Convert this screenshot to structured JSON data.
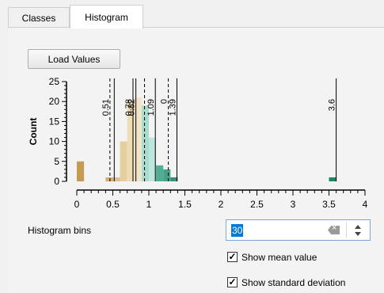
{
  "tabs": [
    {
      "label": "Classes",
      "active": false
    },
    {
      "label": "Histogram",
      "active": true
    }
  ],
  "load_button_label": "Load Values",
  "chart_data": {
    "type": "bar",
    "ylabel": "Count",
    "xlabel": "",
    "xlim": [
      0,
      4
    ],
    "ylim": [
      0,
      25
    ],
    "x_ticks": [
      "0",
      "0.5",
      "1",
      "1.5",
      "2",
      "2.5",
      "3",
      "3.5",
      "4"
    ],
    "y_ticks": [
      "0",
      "5",
      "10",
      "15",
      "20",
      "25"
    ],
    "bin_width": 0.1,
    "bars": [
      {
        "x0": 0.0,
        "value": 5,
        "color": "#c79a54"
      },
      {
        "x0": 0.4,
        "value": 1,
        "color": "#d4ad70"
      },
      {
        "x0": 0.5,
        "value": 1,
        "color": "#dcc08d"
      },
      {
        "x0": 0.6,
        "value": 10,
        "color": "#e5cf9f"
      },
      {
        "x0": 0.7,
        "value": 20,
        "color": "#eedcb5"
      },
      {
        "x0": 0.8,
        "value": 21,
        "color": "#f2e5c7"
      },
      {
        "x0": 0.9,
        "value": 19,
        "color": "#a9ddd0"
      },
      {
        "x0": 1.0,
        "value": 11,
        "color": "#bfe6dc"
      },
      {
        "x0": 1.1,
        "value": 4,
        "color": "#4fae93"
      },
      {
        "x0": 1.2,
        "value": 3,
        "color": "#43a287"
      },
      {
        "x0": 1.3,
        "value": 1,
        "color": "#2f937a"
      },
      {
        "x0": 3.5,
        "value": 1,
        "color": "#1b8567"
      }
    ],
    "markers": [
      {
        "x": 0.52,
        "label": "",
        "style": "solid"
      },
      {
        "x": 0.78,
        "label": "0.78",
        "style": "solid"
      },
      {
        "x": 0.82,
        "label": "0.82",
        "style": "solid"
      },
      {
        "x": 1.09,
        "label": "1.09",
        "style": "solid"
      },
      {
        "x": 1.39,
        "label": "1.39",
        "style": "solid"
      },
      {
        "x": 3.6,
        "label": "3.6",
        "style": "solid"
      },
      {
        "x": 0.46,
        "label": "0.51",
        "style": "dashed"
      },
      {
        "x": 0.94,
        "label": "",
        "style": "dashed"
      },
      {
        "x": 1.27,
        "label": "0",
        "style": "dashed"
      }
    ]
  },
  "bins": {
    "label": "Histogram bins",
    "value": "30"
  },
  "options": [
    {
      "label": "Show mean value",
      "checked": true
    },
    {
      "label": "Show standard deviation",
      "checked": true
    }
  ]
}
